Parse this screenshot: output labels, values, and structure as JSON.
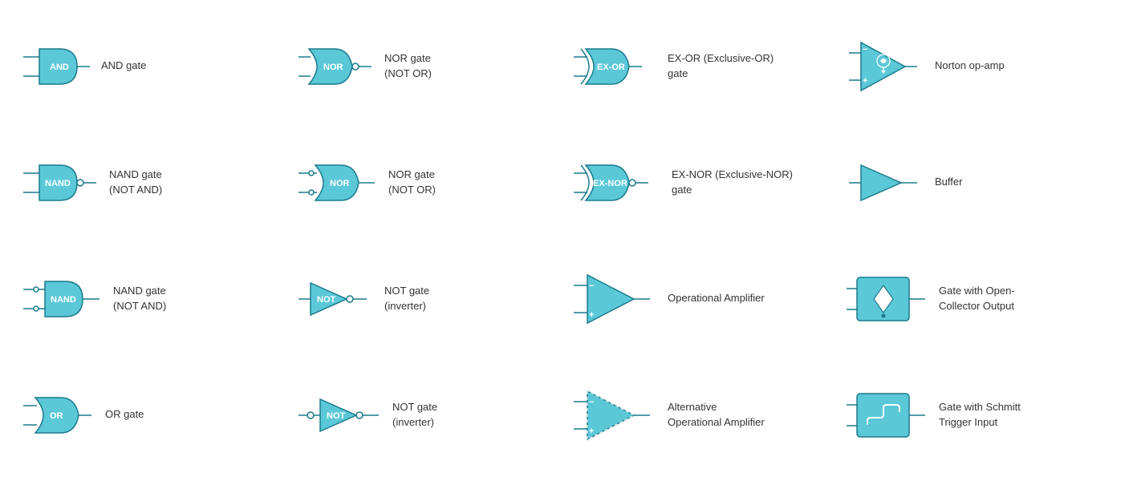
{
  "cells": [
    {
      "id": "and-gate",
      "label": "AND gate",
      "shape": "and"
    },
    {
      "id": "nor-gate-1",
      "label": "NOR gate\n(NOT OR)",
      "shape": "nor"
    },
    {
      "id": "exor-gate",
      "label": "EX-OR (Exclusive-OR)\ngate",
      "shape": "exor"
    },
    {
      "id": "norton-opamp",
      "label": "Norton op-amp",
      "shape": "norton"
    },
    {
      "id": "nand-gate-1",
      "label": "NAND gate\n(NOT AND)",
      "shape": "nand"
    },
    {
      "id": "nor-gate-2",
      "label": "NOR gate\n(NOT OR)",
      "shape": "nor2"
    },
    {
      "id": "exnor-gate",
      "label": "EX-NOR (Exclusive-NOR)\ngate",
      "shape": "exnor"
    },
    {
      "id": "buffer",
      "label": "Buffer",
      "shape": "buffer"
    },
    {
      "id": "nand-gate-2",
      "label": "NAND gate\n(NOT AND)",
      "shape": "nand2"
    },
    {
      "id": "not-gate-1",
      "label": "NOT gate\n(inverter)",
      "shape": "not1"
    },
    {
      "id": "opamp",
      "label": "Operational Amplifier",
      "shape": "opamp"
    },
    {
      "id": "open-collector",
      "label": "Gate with Open-\nCollector Output",
      "shape": "opencollector"
    },
    {
      "id": "or-gate",
      "label": "OR gate",
      "shape": "or"
    },
    {
      "id": "not-gate-2",
      "label": "NOT gate\n(inverter)",
      "shape": "not2"
    },
    {
      "id": "alt-opamp",
      "label": "Alternative\nOperational Amplifier",
      "shape": "altopamp"
    },
    {
      "id": "schmitt",
      "label": "Gate with Schmitt\nTrigger Input",
      "shape": "schmitt"
    }
  ]
}
